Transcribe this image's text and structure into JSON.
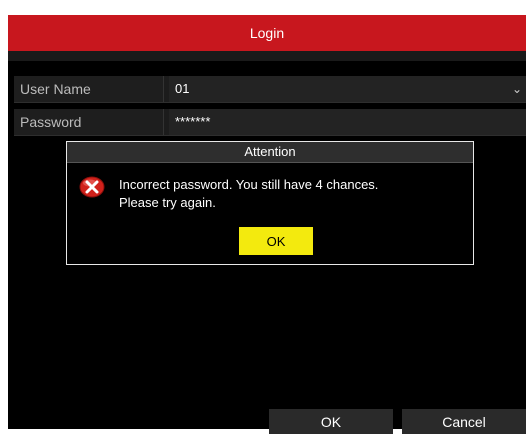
{
  "window": {
    "title": "Login"
  },
  "form": {
    "username_label": "User Name",
    "username_value": "01",
    "password_label": "Password",
    "password_value": "*******"
  },
  "dialog": {
    "title": "Attention",
    "message_line1": "Incorrect password. You still have 4 chances.",
    "message_line2": "Please try again.",
    "ok_label": "OK",
    "icon": "error-x-icon"
  },
  "footer": {
    "ok_label": "OK",
    "cancel_label": "Cancel"
  },
  "colors": {
    "titlebar": "#c8171e",
    "ok_button": "#f3ea0e",
    "error_icon": "#d0211b"
  }
}
